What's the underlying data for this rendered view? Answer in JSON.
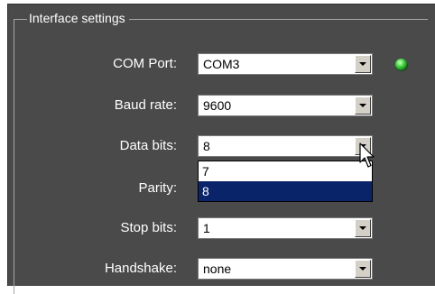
{
  "group": {
    "title": "Interface settings"
  },
  "rows": [
    {
      "label": "COM Port:",
      "value": "COM3"
    },
    {
      "label": "Baud rate:",
      "value": "9600"
    },
    {
      "label": "Data bits:",
      "value": "8"
    },
    {
      "label": "Parity:",
      "value": ""
    },
    {
      "label": "Stop bits:",
      "value": "1"
    },
    {
      "label": "Handshake:",
      "value": "none"
    }
  ],
  "data_bits_dropdown": {
    "options": [
      "7",
      "8"
    ],
    "highlighted": "8"
  },
  "colors": {
    "panel_background": "#4a4a4a",
    "selection": "#0a246a",
    "led_green": "#3ec43e"
  },
  "icons": {
    "status": "green-led-icon",
    "combo_arrow": "chevron-down-icon",
    "pointer": "mouse-cursor-icon"
  }
}
